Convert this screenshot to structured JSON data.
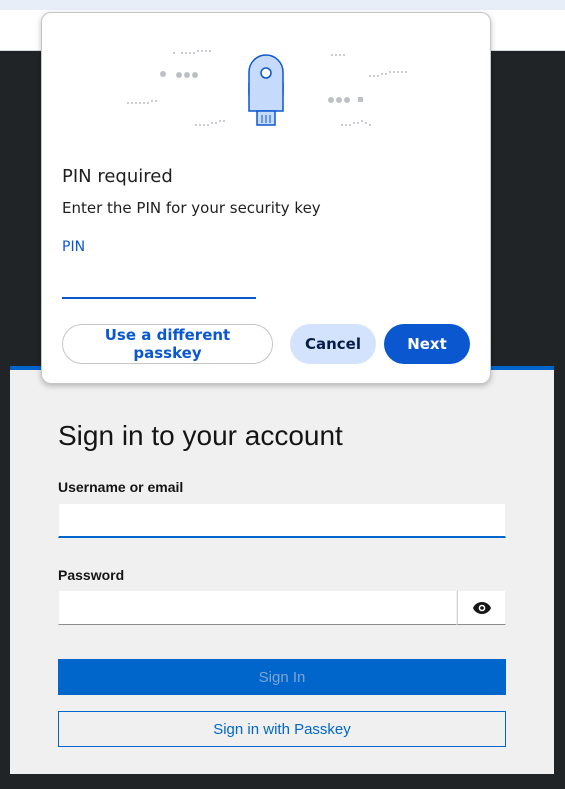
{
  "dialog": {
    "title": "PIN required",
    "description": "Enter the PIN for your security key",
    "pin_label": "PIN",
    "pin_value": "",
    "buttons": {
      "different_passkey": "Use a different passkey",
      "cancel": "Cancel",
      "next": "Next"
    },
    "illustration_icon": "security-key-icon"
  },
  "login": {
    "title": "Sign in to your account",
    "username_label": "Username or email",
    "username_value": "",
    "password_label": "Password",
    "password_value": "",
    "show_password_icon": "eye-icon",
    "sign_in_label": "Sign In",
    "passkey_label": "Sign in with Passkey"
  },
  "colors": {
    "page_background": "#212427",
    "dialog_accent": "#0b57d0",
    "dialog_tonal": "#d3e3fd",
    "login_accent": "#0066cc",
    "login_card": "#f0f0f0"
  }
}
